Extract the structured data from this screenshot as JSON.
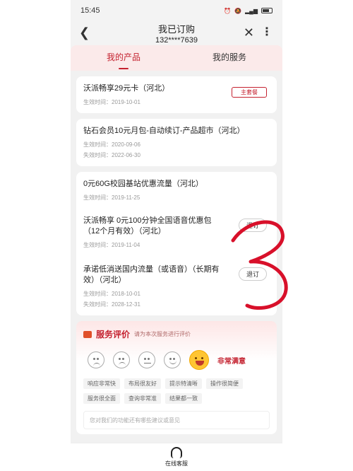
{
  "status_bar": {
    "time": "15:45",
    "icons": [
      "alarm-icon",
      "mute-icon",
      "nfc-icon",
      "hd-icon",
      "5g-icon",
      "signal-icon",
      "battery-icon"
    ]
  },
  "header": {
    "title": "我已订购",
    "phone": "132****7639"
  },
  "tabs": [
    {
      "label": "我的产品",
      "active": true
    },
    {
      "label": "我的服务",
      "active": false
    }
  ],
  "products": [
    {
      "name": "沃派畅享29元卡（河北）",
      "tag": "主套餐",
      "dates": [
        "生效时间：2019-10-01"
      ]
    },
    {
      "name": "钻石会员10元月包-自动续订-产品超市（河北）",
      "dates": [
        "生效时间：2020-09-06",
        "失效时间：2022-06-30"
      ]
    },
    {
      "name": "0元60G校园基站优惠流量（河北）",
      "dates": [
        "生效时间：2019-11-25"
      ]
    },
    {
      "name": "沃派畅享 0元100分钟全国语音优惠包（12个月有效）（河北）",
      "action": "退订",
      "dates": [
        "生效时间：2019-11-04"
      ]
    },
    {
      "name": "承诺低消送国内流量（或语音）（长期有效）（河北）",
      "action": "退订",
      "dates": [
        "生效时间：2018-10-01",
        "失效时间：2028-12-31"
      ]
    }
  ],
  "rating": {
    "title": "服务评价",
    "subtitle": "请为本次服务进行评价",
    "selected_label": "非常满意",
    "chips": [
      "响应非常快",
      "布局很友好",
      "提示特清晰",
      "操作很简便",
      "服务很全面",
      "查询非常准",
      "结果都一致"
    ],
    "feedback_placeholder": "您对我们的功能还有哪些建议或意见"
  },
  "bottom": {
    "label": "在线客服"
  },
  "colors": {
    "accent": "#c4212f",
    "background": "#f1f1f1",
    "scribble": "#d8102a"
  }
}
